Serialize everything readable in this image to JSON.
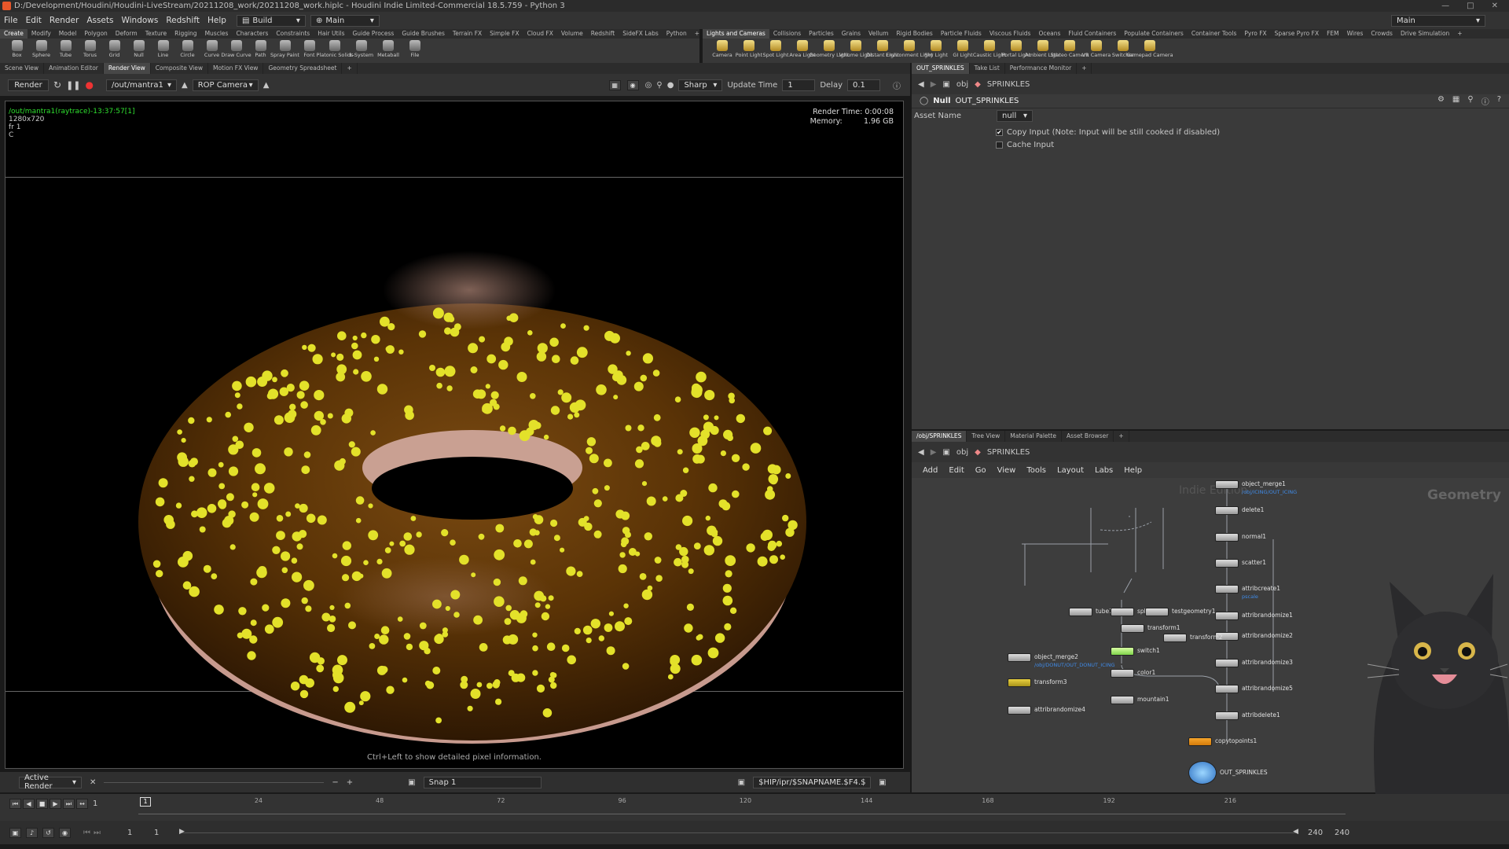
{
  "window": {
    "title": "D:/Development/Houdini/Houdini-LiveStream/20211208_work/20211208_work.hiplc - Houdini Indie Limited-Commercial 18.5.759 - Python 3"
  },
  "menu": {
    "items": [
      "File",
      "Edit",
      "Render",
      "Assets",
      "Windows",
      "Redshift",
      "Help"
    ],
    "desktop": "Build",
    "context": "Main",
    "right_desktop": "Main"
  },
  "shelf_tabs_left": [
    "Create",
    "Modify",
    "Model",
    "Polygon",
    "Deform",
    "Texture",
    "Rigging",
    "Muscles",
    "Characters",
    "Constraints",
    "Hair Utils",
    "Guide Process",
    "Guide Brushes",
    "Terrain FX",
    "Simple FX",
    "Cloud FX",
    "Volume",
    "Redshift",
    "SideFX Labs",
    "Python"
  ],
  "shelf_tabs_right": [
    "Lights and Cameras",
    "Collisions",
    "Particles",
    "Grains",
    "Vellum",
    "Rigid Bodies",
    "Particle Fluids",
    "Viscous Fluids",
    "Oceans",
    "Fluid Containers",
    "Populate Containers",
    "Container Tools",
    "Pyro FX",
    "Sparse Pyro FX",
    "FEM",
    "Wires",
    "Crowds",
    "Drive Simulation"
  ],
  "tools_left": [
    "Box",
    "Sphere",
    "Tube",
    "Torus",
    "Grid",
    "Null",
    "Line",
    "Circle",
    "Curve",
    "Draw Curve",
    "Path",
    "Spray Paint",
    "Font",
    "Platonic Solids",
    "L-System",
    "Metaball",
    "File"
  ],
  "tools_right": [
    "Camera",
    "Point Light",
    "Spot Light",
    "Area Light",
    "Geometry Light",
    "Volume Light",
    "Distant Light",
    "Environment Light",
    "Sky Light",
    "GI Light",
    "Caustic Light",
    "Portal Light",
    "Ambient Light",
    "Stereo Camera",
    "VR Camera",
    "Switcher",
    "Gamepad Camera"
  ],
  "viewer_tabs": [
    "Scene View",
    "Animation Editor",
    "Render View",
    "Composite View",
    "Motion FX View",
    "Geometry Spreadsheet"
  ],
  "render_toolbar": {
    "render_label": "Render",
    "output_path": "/out/mantra1",
    "camera": "ROP Camera",
    "quality": "Sharp",
    "update_label": "Update Time",
    "update_value": "1",
    "delay_label": "Delay",
    "delay_value": "0.1"
  },
  "render_view": {
    "info_path": "/out/mantra1(raytrace)-13:37:57[1]",
    "resolution": "1280x720",
    "frame_info": "fr 1",
    "channel": "C",
    "render_time": "Render Time: 0:00:08",
    "memory_label": "Memory:",
    "memory_value": "1.96 GB",
    "hint": "Ctrl+Left to show detailed pixel information."
  },
  "render_bottom": {
    "mode": "Active Render",
    "snap": "Snap 1",
    "snap_path": "$HIP/ipr/$SNAPNAME.$F4.$"
  },
  "param_tabs": [
    "OUT_SPRINKLES",
    "Take List",
    "Performance Monitor"
  ],
  "param_path": {
    "context": "obj",
    "node": "SPRINKLES"
  },
  "params": {
    "node_type": "Null",
    "node_name": "OUT_SPRINKLES",
    "asset_name_label": "Asset Name",
    "asset_name_value": "null",
    "copy_input": "Copy Input (Note: Input will be still cooked if disabled)",
    "cache_input": "Cache Input",
    "copy_input_checked": true,
    "cache_input_checked": false
  },
  "network_tabs": [
    "/obj/SPRINKLES",
    "Tree View",
    "Material Palette",
    "Asset Browser"
  ],
  "network_path": {
    "context": "obj",
    "node": "SPRINKLES"
  },
  "network_menu": [
    "Add",
    "Edit",
    "Go",
    "View",
    "Tools",
    "Layout",
    "Labs",
    "Help"
  ],
  "network": {
    "watermark_left": "Indie Edition",
    "watermark_right": "Geometry",
    "nodes": [
      {
        "name": "object_merge1",
        "path": "/obj/ICING/OUT_ICING"
      },
      {
        "name": "delete1"
      },
      {
        "name": "normal1"
      },
      {
        "name": "scatter1"
      },
      {
        "name": "attribcreate1",
        "path": "pscale"
      },
      {
        "name": "attribrandomize1"
      },
      {
        "name": "attribrandomize2"
      },
      {
        "name": "attribrandomize3"
      },
      {
        "name": "attribrandomize5"
      },
      {
        "name": "attribdelete1"
      },
      {
        "name": "tube1"
      },
      {
        "name": "sphere1"
      },
      {
        "name": "testgeometry1"
      },
      {
        "name": "transform1"
      },
      {
        "name": "transform2"
      },
      {
        "name": "switch1"
      },
      {
        "name": "object_merge2",
        "path": "/obj/DONUT/OUT_DONUT_ICING"
      },
      {
        "name": "transform3"
      },
      {
        "name": "color1"
      },
      {
        "name": "mountain1"
      },
      {
        "name": "attribrandomize4"
      },
      {
        "name": "copytopoints1"
      },
      {
        "name": "OUT_SPRINKLES"
      }
    ]
  },
  "timeline": {
    "current_frame": "1",
    "ticks": [
      "1",
      "24",
      "48",
      "72",
      "96",
      "120",
      "144",
      "168",
      "192",
      "216"
    ],
    "start": "1",
    "start2": "1",
    "end": "240",
    "end2": "240"
  },
  "colors": {
    "accent": "#f6a52c",
    "render_text": "#2fe02f",
    "donut_chocolate": "#5a3306",
    "donut_dough": "#c79a8e",
    "sprinkles": "#e3e12a"
  }
}
